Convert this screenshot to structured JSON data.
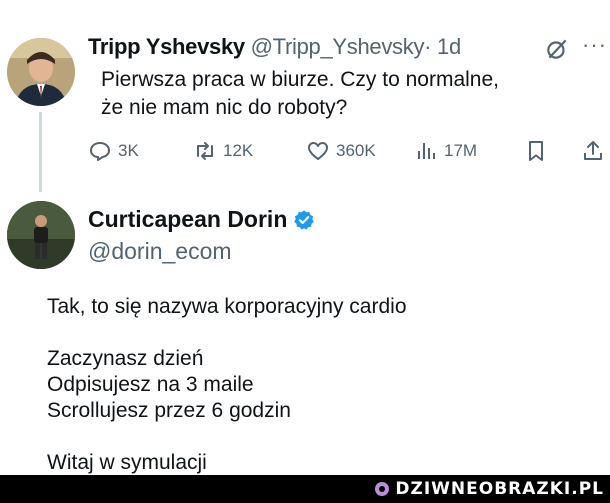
{
  "tweet1": {
    "display_name": "Tripp Yshevsky",
    "handle": "@Tripp_Yshevsky",
    "time": "· 1d",
    "text": "Pierwsza praca w biurze. Czy to normalne, że nie mam nic do roboty?",
    "actions": {
      "replies": "3K",
      "reposts": "12K",
      "likes": "360K",
      "views": "17M"
    },
    "more": "···"
  },
  "tweet2": {
    "display_name": "Curticapean Dorin",
    "handle": "@dorin_ecom",
    "lines": [
      "Tak, to się nazywa korporacyjny cardio",
      "",
      "Zaczynasz dzień",
      "Odpisujesz na 3 maile",
      "Scrollujesz przez 6 godzin",
      "",
      "Witaj w symulacji"
    ]
  },
  "watermark": {
    "text": "DZIWNEOBRAZKI.PL"
  },
  "colors": {
    "verified": "#1d9bf0",
    "muted": "#536471",
    "text": "#0f1419"
  }
}
